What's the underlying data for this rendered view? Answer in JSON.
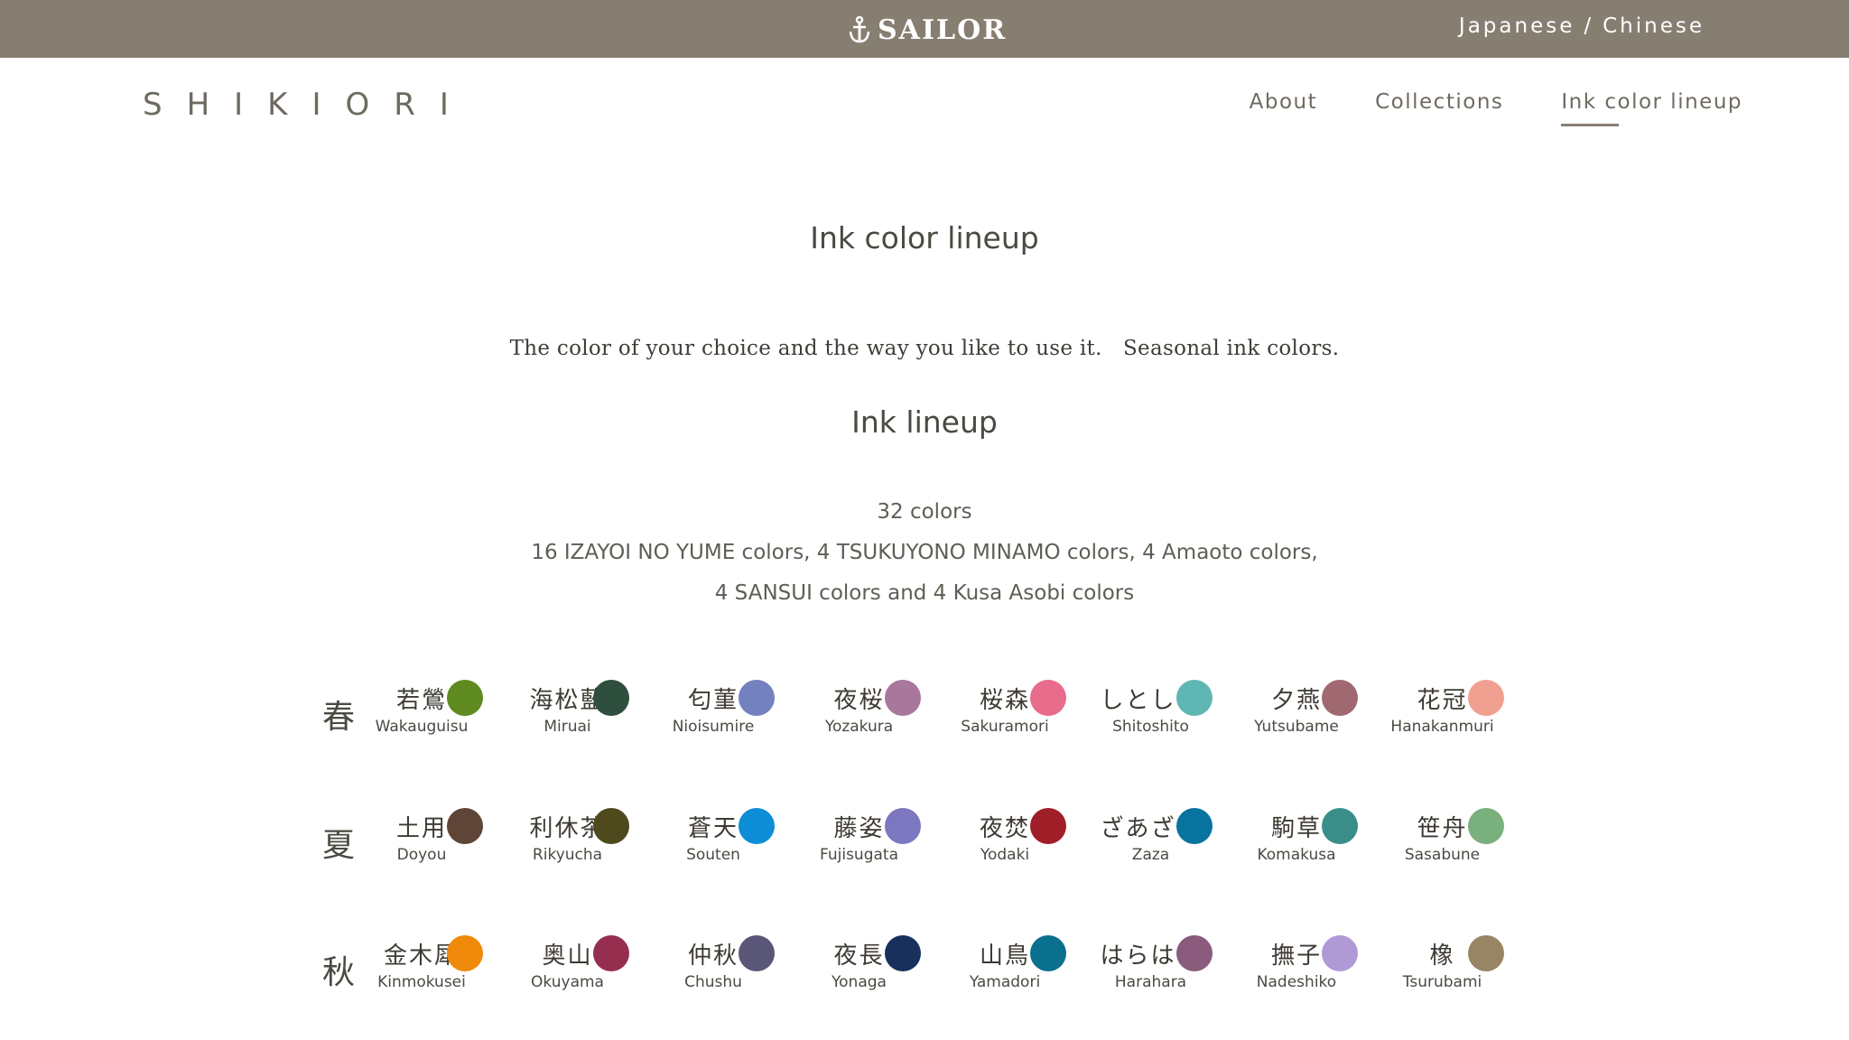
{
  "header": {
    "brand": "SAILOR",
    "lang_japanese": "Japanese",
    "lang_separator": "/",
    "lang_chinese": "Chinese"
  },
  "site": {
    "logo": "SHIKIORI",
    "nav": [
      "About",
      "Collections",
      "Ink color lineup"
    ],
    "active_nav": "Ink color lineup"
  },
  "main": {
    "page_title": "Ink color lineup",
    "tagline": "The color of your choice and the way you like to use it.　Seasonal ink colors.",
    "section_title": "Ink lineup",
    "count": "32 colors",
    "series_line1": "16 IZAYOI NO YUME colors, 4 TSUKUYONO MINAMO colors, 4 Amaoto colors,",
    "series_line2": "4 SANSUI colors and 4 Kusa Asobi colors"
  },
  "seasons": [
    {
      "season": "春",
      "inks": [
        {
          "kanji": "若鶯",
          "name": "Wakauguisu",
          "color": "#5e8a1f"
        },
        {
          "kanji": "海松藍",
          "name": "Miruai",
          "color": "#2f4f3e"
        },
        {
          "kanji": "匂菫",
          "name": "Nioisumire",
          "color": "#7381c0"
        },
        {
          "kanji": "夜桜",
          "name": "Yozakura",
          "color": "#a9769c"
        },
        {
          "kanji": "桜森",
          "name": "Sakuramori",
          "color": "#e76c8c"
        },
        {
          "kanji": "しとしと",
          "name": "Shitoshito",
          "color": "#5fb7b4"
        },
        {
          "kanji": "夕燕",
          "name": "Yutsubame",
          "color": "#a06870"
        },
        {
          "kanji": "花冠",
          "name": "Hanakanmuri",
          "color": "#f0a090"
        }
      ]
    },
    {
      "season": "夏",
      "inks": [
        {
          "kanji": "土用",
          "name": "Doyou",
          "color": "#5e4537"
        },
        {
          "kanji": "利休茶",
          "name": "Rikyucha",
          "color": "#4e4a1e"
        },
        {
          "kanji": "蒼天",
          "name": "Souten",
          "color": "#0e8ed6"
        },
        {
          "kanji": "藤姿",
          "name": "Fujisugata",
          "color": "#7d76c0"
        },
        {
          "kanji": "夜焚",
          "name": "Yodaki",
          "color": "#a01e27"
        },
        {
          "kanji": "ざあざあ",
          "name": "Zaza",
          "color": "#07739e"
        },
        {
          "kanji": "駒草",
          "name": "Komakusa",
          "color": "#3a8e8a"
        },
        {
          "kanji": "笹舟",
          "name": "Sasabune",
          "color": "#7aaf7e"
        }
      ]
    },
    {
      "season": "秋",
      "inks": [
        {
          "kanji": "金木犀",
          "name": "Kinmokusei",
          "color": "#f08a0a"
        },
        {
          "kanji": "奥山",
          "name": "Okuyama",
          "color": "#962f4f"
        },
        {
          "kanji": "仲秋",
          "name": "Chushu",
          "color": "#5a5677"
        },
        {
          "kanji": "夜長",
          "name": "Yonaga",
          "color": "#17315c"
        },
        {
          "kanji": "山鳥",
          "name": "Yamadori",
          "color": "#0b6f8e"
        },
        {
          "kanji": "はらはら",
          "name": "Harahara",
          "color": "#8a5b7c"
        },
        {
          "kanji": "撫子",
          "name": "Nadeshiko",
          "color": "#b09ad6"
        },
        {
          "kanji": "橡",
          "name": "Tsurubami",
          "color": "#988563"
        }
      ]
    }
  ]
}
